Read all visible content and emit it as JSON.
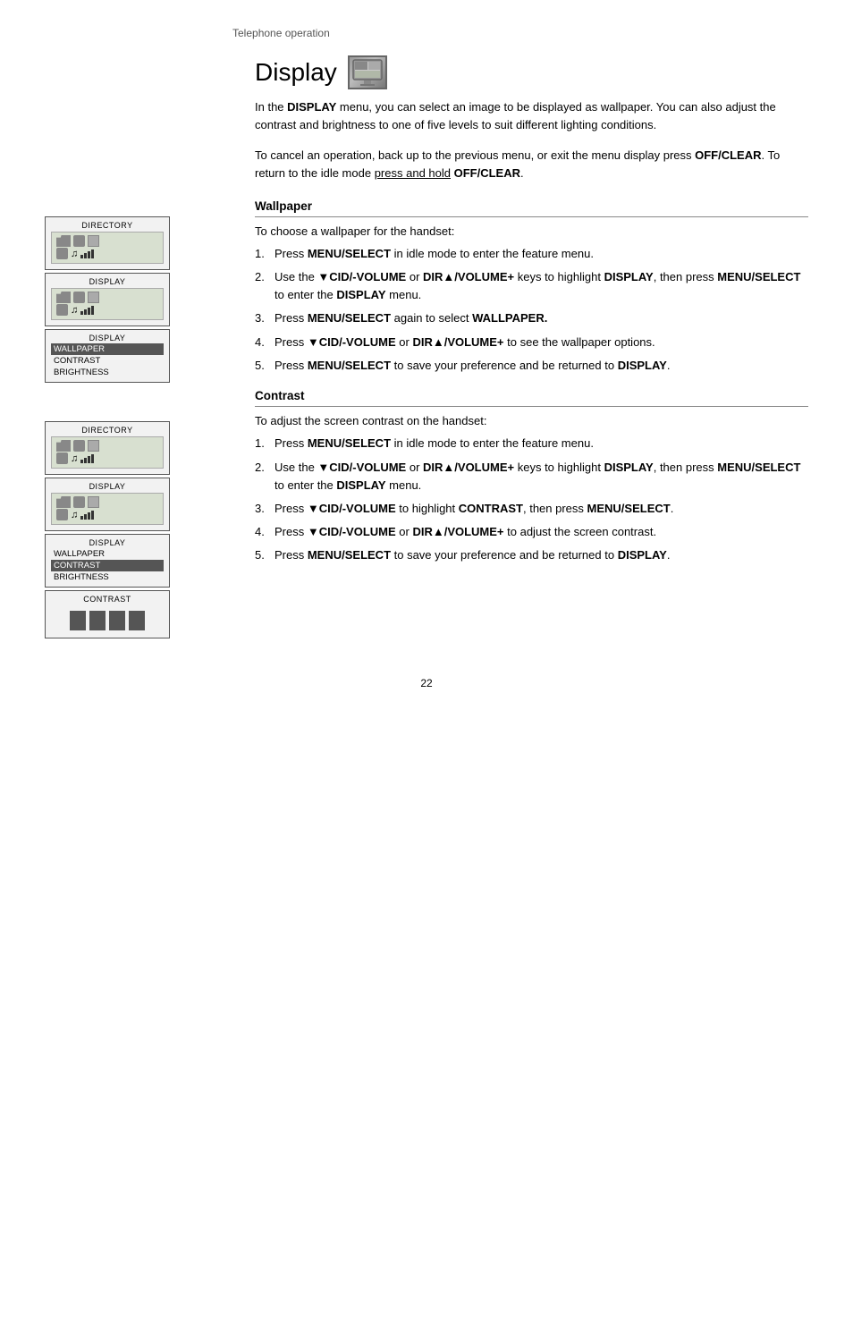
{
  "header": {
    "breadcrumb": "Telephone operation"
  },
  "page": {
    "title": "Display",
    "page_number": "22"
  },
  "intro": {
    "paragraph1": "In the DISPLAY menu, you can select an image to be displayed as wallpaper. You can also adjust the contrast and brightness to one of five levels to suit different lighting conditions.",
    "paragraph2_start": "To cancel an operation, back up to the previous menu, or exit the menu display press ",
    "paragraph2_bold1": "OFF/CLEAR",
    "paragraph2_mid": ". To return to the idle mode ",
    "paragraph2_underline": "press and hold",
    "paragraph2_bold2": "OFF/CLEAR",
    "paragraph2_end": "."
  },
  "wallpaper_section": {
    "heading": "Wallpaper",
    "intro": "To choose a wallpaper for the handset:",
    "steps": [
      {
        "num": "1.",
        "text_start": "Press ",
        "bold": "MENU/SELECT",
        "text_end": " in idle mode to enter the feature menu."
      },
      {
        "num": "2.",
        "text_start": "Use the ",
        "bold1": "▼CID/-VOLUME",
        "text_mid1": " or ",
        "bold2": "DIR▲/VOLUME+",
        "text_mid2": " keys to highlight ",
        "bold3": "DISPLAY",
        "text_mid3": ", then press ",
        "bold4": "MENU/SELECT",
        "text_end": " to enter the ",
        "bold5": "DISPLAY",
        "text_end2": " menu."
      },
      {
        "num": "3.",
        "text_start": "Press ",
        "bold": "MENU/SELECT",
        "text_end": " again to select ",
        "bold2": "WALLPAPER."
      },
      {
        "num": "4.",
        "text_start": "Press ",
        "bold1": "▼CID/-VOLUME",
        "text_mid": " or ",
        "bold2": "DIR▲/VOLUME+",
        "text_end": " to see the wallpaper options."
      },
      {
        "num": "5.",
        "text_start": "Press ",
        "bold": "MENU/SELECT",
        "text_end": " to save your preference and be returned to ",
        "bold2": "DISPLAY",
        "text_end2": "."
      }
    ]
  },
  "contrast_section": {
    "heading": "Contrast",
    "intro": "To adjust the screen contrast on the handset:",
    "steps": [
      {
        "num": "1.",
        "text_start": "Press ",
        "bold": "MENU/SELECT",
        "text_end": " in idle mode to enter the feature menu."
      },
      {
        "num": "2.",
        "text_start": "Use the ",
        "bold1": "▼CID/-VOLUME",
        "text_mid1": " or ",
        "bold2": "DIR▲/VOLUME+",
        "text_mid2": " keys to highlight ",
        "bold3": "DISPLAY",
        "text_mid3": ", then press ",
        "bold4": "MENU/SELECT",
        "text_end": " to enter the ",
        "bold5": "DISPLAY",
        "text_end2": " menu."
      },
      {
        "num": "3.",
        "text_start": "Press ",
        "bold1": "▼CID/-VOLUME",
        "text_mid": " to highlight ",
        "bold2": "CONTRAST",
        "text_end": ", then press ",
        "bold3": "MENU/SELECT",
        "text_end2": "."
      },
      {
        "num": "4.",
        "text_start": "Press ",
        "bold1": "▼CID/-VOLUME",
        "text_mid": " or ",
        "bold2": "DIR▲/VOLUME+",
        "text_end": " to adjust the screen contrast."
      },
      {
        "num": "5.",
        "text_start": "Press ",
        "bold": "MENU/SELECT",
        "text_end": " to save your preference and be returned to ",
        "bold2": "DISPLAY",
        "text_end2": "."
      }
    ]
  },
  "screens": {
    "directory_label": "DIRECTORY",
    "display_label": "DISPLAY",
    "menu_items": [
      "WALLPAPER",
      "CONTRAST",
      "BRIGHTNESS"
    ],
    "contrast_label": "CONTRAST"
  }
}
